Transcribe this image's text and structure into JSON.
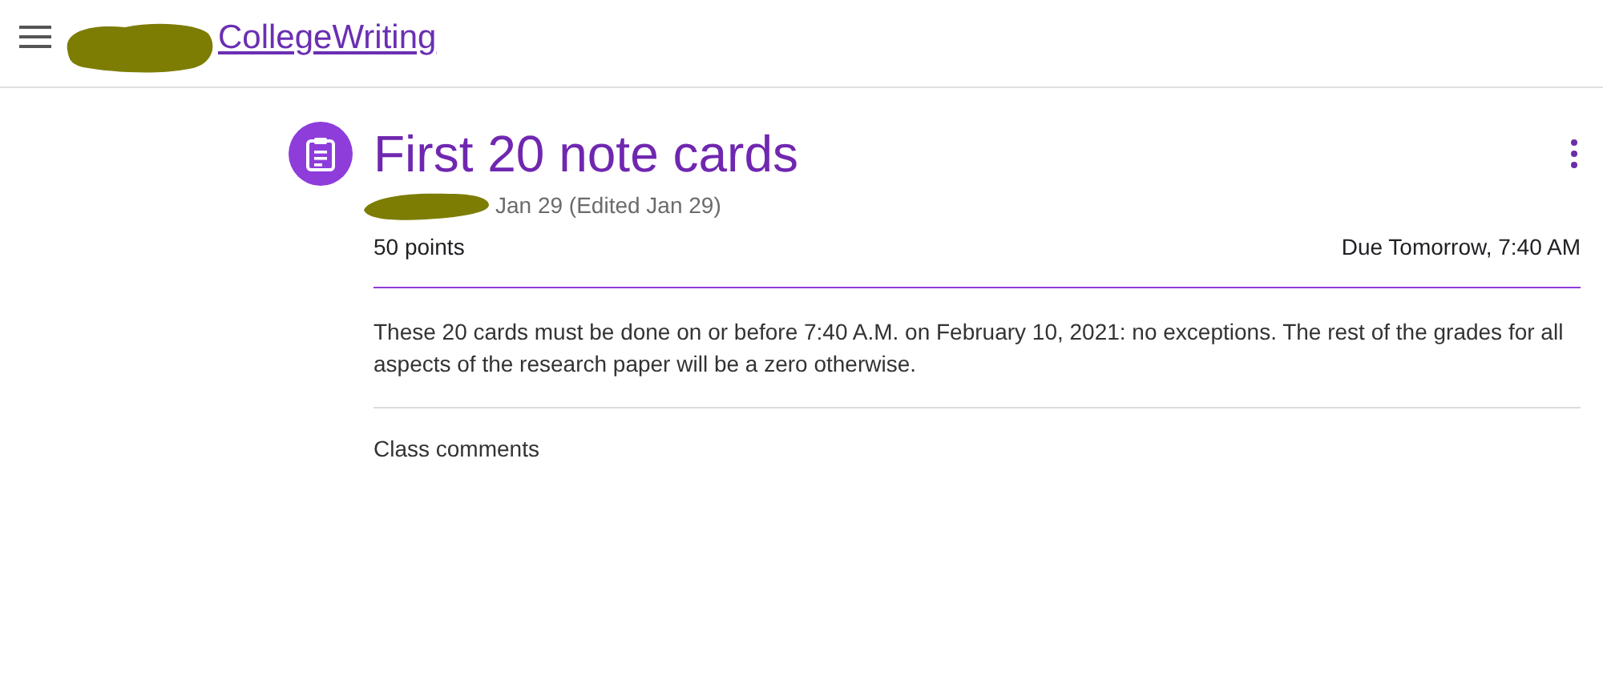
{
  "header": {
    "class_link": "CollegeWriting"
  },
  "assignment": {
    "title": "First 20 note cards",
    "date": "Jan 29 (Edited Jan 29)",
    "points": "50 points",
    "due": "Due Tomorrow, 7:40 AM",
    "description": "These 20 cards must be done on or before 7:40 A.M. on February 10, 2021: no exceptions. The rest of the grades for all aspects of the research paper will be a zero otherwise."
  },
  "comments": {
    "heading": "Class comments"
  }
}
